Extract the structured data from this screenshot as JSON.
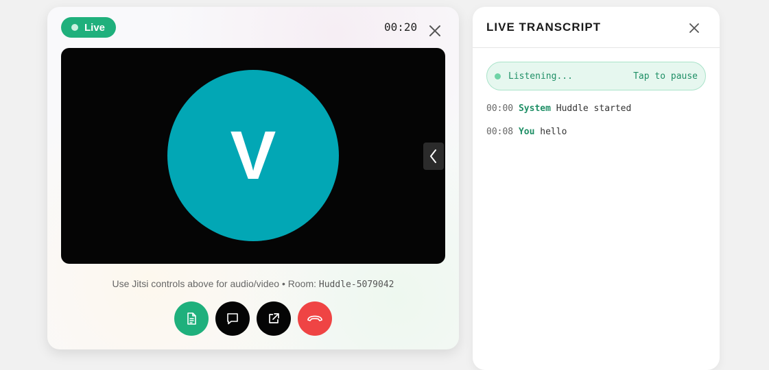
{
  "call": {
    "status_label": "Live",
    "timer": "00:20",
    "avatar_initial": "V",
    "hint_text": "Use Jitsi controls above for audio/video • Room: ",
    "room_name": "Huddle-5079042",
    "controls": [
      {
        "name": "transcript-button",
        "icon": "document-icon",
        "color": "#1fb07c"
      },
      {
        "name": "chat-button",
        "icon": "chat-bubble-icon",
        "color": "#050505"
      },
      {
        "name": "popout-button",
        "icon": "external-link-icon",
        "color": "#050505"
      },
      {
        "name": "hang-up-button",
        "icon": "phone-hangup-icon",
        "color": "#ef4444"
      }
    ]
  },
  "transcript": {
    "title": "LIVE TRANSCRIPT",
    "listening_label": "Listening...",
    "pause_label": "Tap to pause",
    "entries": [
      {
        "time": "00:00",
        "speaker": "System",
        "text": "Huddle started"
      },
      {
        "time": "00:08",
        "speaker": "You",
        "text": "hello"
      }
    ]
  },
  "colors": {
    "accent_green": "#1fb07c",
    "avatar_teal": "#02a7b5",
    "hangup_red": "#ef4444"
  }
}
